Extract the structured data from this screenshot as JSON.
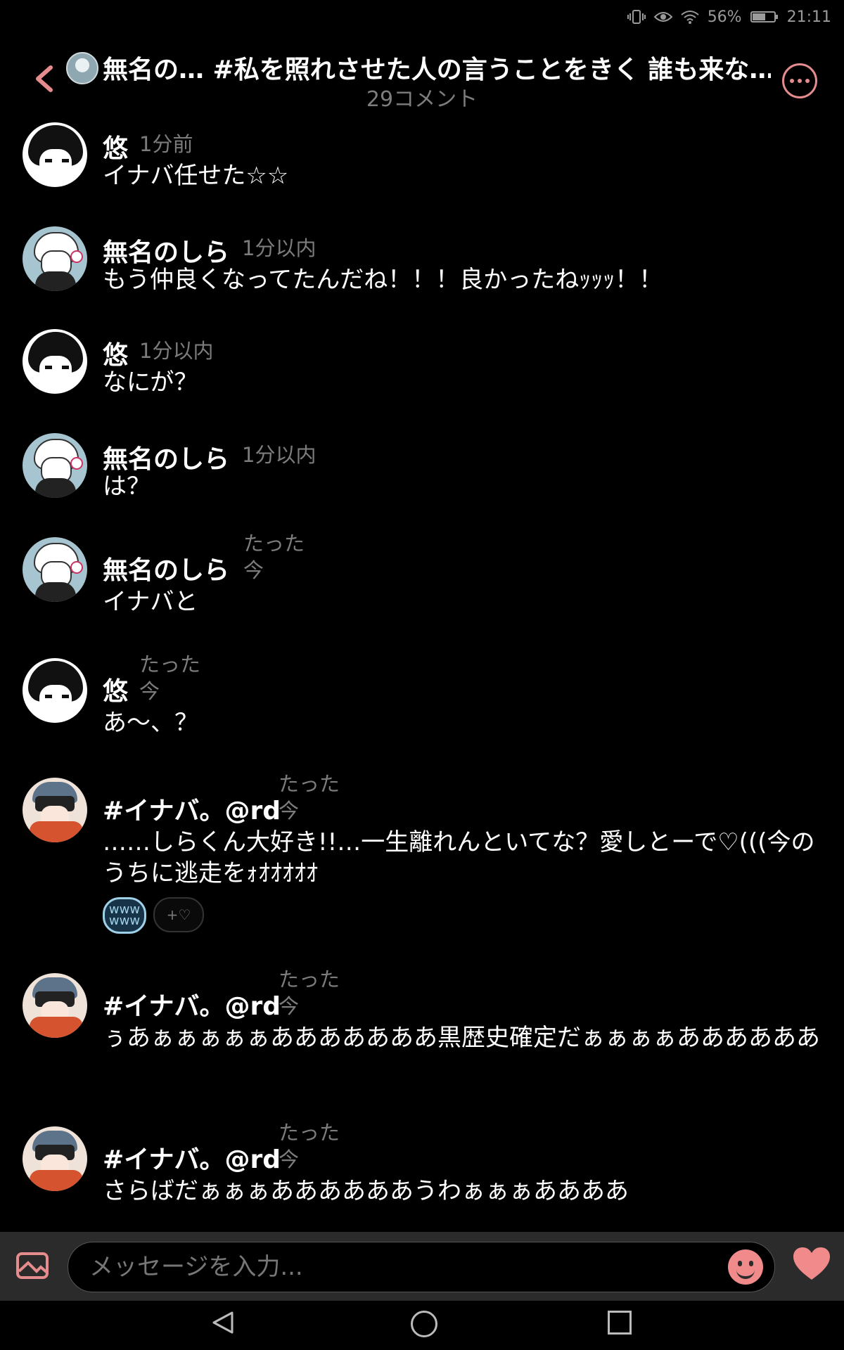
{
  "status": {
    "battery": "56%",
    "time": "21:11"
  },
  "header": {
    "title": "無名の… #私を照れさせた人の言うことをきく 誰も来な…",
    "subtitle": "29コメント"
  },
  "comments": [
    {
      "name": "悠",
      "time": "1分前",
      "text": "イナバ任せた☆☆"
    },
    {
      "name": "無名のしら",
      "time": "1分以内",
      "text": "もう仲良くなってたんだね！！！良かったねｯｯｯ！！"
    },
    {
      "name": "悠",
      "time": "1分以内",
      "text": "なにが？"
    },
    {
      "name": "無名のしら",
      "time": "1分以内",
      "text": "は？"
    },
    {
      "name": "無名のしら",
      "time_l1": "たった",
      "time_l2": "今",
      "text": "イナバと"
    },
    {
      "name": "悠",
      "time_l1": "たった",
      "time_l2": "今",
      "text": "あ〜、？"
    },
    {
      "name": "#イナバ。@rd",
      "time_l1": "たった",
      "time_l2": "今",
      "text": "……しらくん大好き!!…一生離れんといてな？愛しとーで♡(((今のうちに逃走をｫｵｵｵｵｵ",
      "reaction": "www\nwww",
      "reaction_add": "+♡"
    },
    {
      "name": "#イナバ。@rd",
      "time_l1": "たった",
      "time_l2": "今",
      "text": "ぅあぁぁぁぁぁあああああああ黒歴史確定だぁぁぁぁああああああ"
    },
    {
      "name": "#イナバ。@rd",
      "time_l1": "たった",
      "time_l2": "今",
      "text": "さらばだぁぁぁああああああうわぁぁぁああああ"
    }
  ],
  "composer": {
    "placeholder": "メッセージを入力..."
  },
  "colors": {
    "accent": "#e58c8e",
    "background": "#000000",
    "muted": "#7c7c7c"
  }
}
